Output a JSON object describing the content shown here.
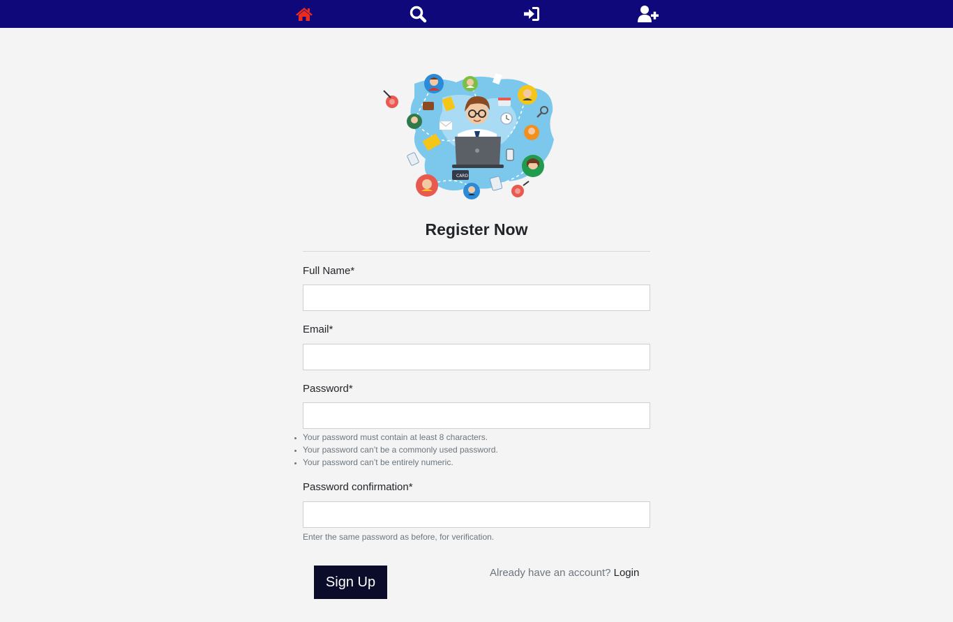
{
  "nav": {
    "icons": [
      "home-icon",
      "search-icon",
      "sign-in-icon",
      "user-plus-icon"
    ],
    "home_color": "#ea2b1f",
    "bar_color": "#0f087a"
  },
  "form": {
    "title": "Register Now",
    "fields": [
      {
        "label": "Full Name*",
        "value": "",
        "placeholder": ""
      },
      {
        "label": "Email*",
        "value": "",
        "placeholder": ""
      },
      {
        "label": "Password*",
        "value": "",
        "placeholder": ""
      },
      {
        "label": "Password confirmation*",
        "value": "",
        "placeholder": ""
      }
    ],
    "password_help": [
      "Your password must contain at least 8 characters.",
      "Your password can’t be a commonly used password.",
      "Your password can’t be entirely numeric."
    ],
    "confirm_help": "Enter the same password as before, for verification.",
    "submit_label": "Sign Up",
    "login_prompt": "Already have an account?",
    "login_link": "Login"
  },
  "illustration": {
    "subject": "person at laptop surrounded by connected people avatars on world map",
    "card_text": "CARD"
  }
}
